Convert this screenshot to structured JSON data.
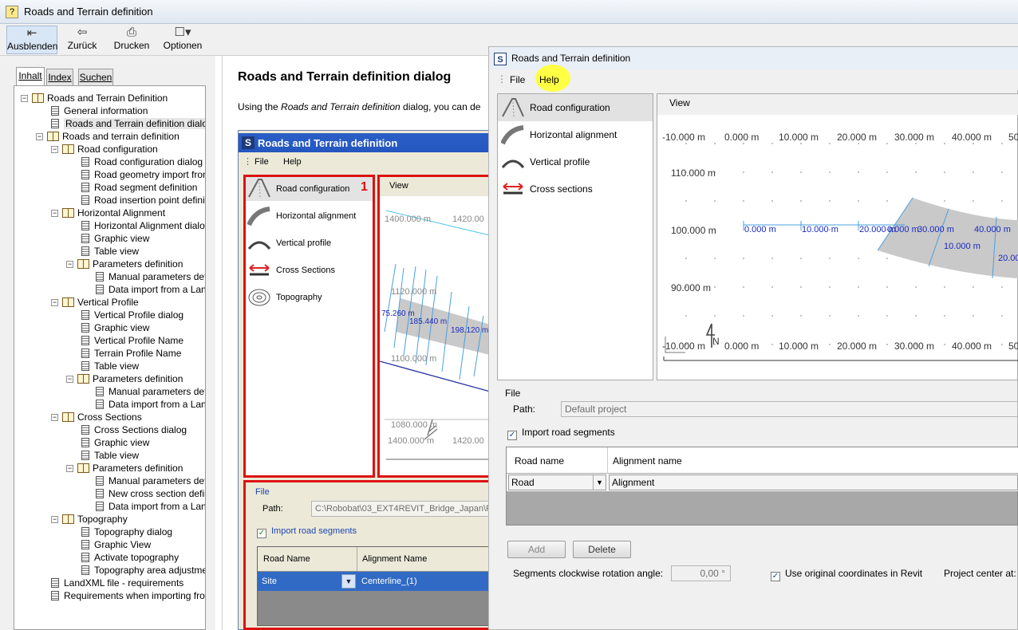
{
  "help_window": {
    "title": "Roads and Terrain definition",
    "toolbar": [
      {
        "label": "Ausblenden",
        "icon": "hide-icon"
      },
      {
        "label": "Zurück",
        "icon": "back-arrow-icon"
      },
      {
        "label": "Drucken",
        "icon": "printer-icon"
      },
      {
        "label": "Optionen",
        "icon": "options-icon"
      }
    ],
    "tabs": [
      "Inhalt",
      "Index",
      "Suchen"
    ],
    "tree": [
      {
        "label": "Roads and Terrain Definition"
      },
      {
        "label": "General information"
      },
      {
        "label": "Roads and Terrain definition dialog"
      },
      {
        "label": "Roads and terrain definition"
      },
      {
        "label": "Road configuration"
      },
      {
        "label": "Road configuration dialog"
      },
      {
        "label": "Road geometry import from a"
      },
      {
        "label": "Road segment definition"
      },
      {
        "label": "Road insertion point definitic"
      },
      {
        "label": "Horizontal Alignment"
      },
      {
        "label": "Horizontal Alignment dialog"
      },
      {
        "label": "Graphic view"
      },
      {
        "label": "Table view"
      },
      {
        "label": "Parameters definition"
      },
      {
        "label": "Manual parameters defi"
      },
      {
        "label": "Data import from a Lanc"
      },
      {
        "label": "Vertical Profile"
      },
      {
        "label": "Vertical Profile dialog"
      },
      {
        "label": "Graphic view"
      },
      {
        "label": "Vertical Profile Name"
      },
      {
        "label": "Terrain Profile Name"
      },
      {
        "label": "Table view"
      },
      {
        "label": "Parameters definition"
      },
      {
        "label": "Manual parameters defi"
      },
      {
        "label": "Data import from a Lanc"
      },
      {
        "label": "Cross Sections"
      },
      {
        "label": "Cross Sections dialog"
      },
      {
        "label": "Graphic view"
      },
      {
        "label": "Table view"
      },
      {
        "label": "Parameters definition"
      },
      {
        "label": "Manual parameters defi"
      },
      {
        "label": "New cross section defir"
      },
      {
        "label": "Data import from a Lanc"
      },
      {
        "label": "Topography"
      },
      {
        "label": "Topography dialog"
      },
      {
        "label": "Graphic View"
      },
      {
        "label": "Activate topography"
      },
      {
        "label": "Topography area adjustmer"
      },
      {
        "label": "LandXML file - requirements"
      },
      {
        "label": "Requirements when importing from /"
      }
    ],
    "content": {
      "heading": "Roads and Terrain definition dialog",
      "intro_pre": "Using the ",
      "intro_em": "Roads and Terrain definition",
      "intro_post": " dialog, you can de"
    }
  },
  "embedded_shot": {
    "title": "Roads and Terrain definition",
    "menu": [
      "File",
      "Help"
    ],
    "sidebar": [
      "Road configuration",
      "Horizontal alignment",
      "Vertical profile",
      "Cross Sections",
      "Topography"
    ],
    "callout": "1",
    "view_label": "View",
    "ruler_top": [
      "1400.000 m",
      "1420.00"
    ],
    "ruler_bottom": [
      "1400.000 m",
      "1420.00"
    ],
    "y_labels": [
      "1120.000 m",
      "1100.000 m",
      "1080.000 m"
    ],
    "stations": [
      "75.260 m",
      "185.440 m",
      "198.120 m"
    ],
    "file_group": "File",
    "path_label": "Path:",
    "path_value": "C:\\Robobat\\03_EXT4REVIT_Bridge_Japan\\F",
    "import_label": "Import road segments",
    "col1": "Road Name",
    "col2": "Alignment Name",
    "row_road": "Site",
    "row_alignment": "Centerline_(1)"
  },
  "dialog": {
    "title": "Roads and Terrain definition",
    "menu": [
      "File",
      "Help"
    ],
    "sidebar": [
      "Road configuration",
      "Horizontal alignment",
      "Vertical profile",
      "Cross sections"
    ],
    "view_label": "View",
    "x_ruler": [
      "-10.000 m",
      "0.000 m",
      "10.000 m",
      "20.000 m",
      "30.000 m",
      "40.000 m",
      "50"
    ],
    "y_ruler": [
      "110.000 m",
      "100.000 m",
      "90.000 m"
    ],
    "axis_marks": [
      "0.000 m",
      "10.000 m",
      "20.000 m"
    ],
    "road_marks": [
      "0.000 m",
      "30.000 m",
      "40.000 m",
      "10.000 m",
      "20.00"
    ],
    "compass": "N",
    "file_group": "File",
    "path_label": "Path:",
    "path_value": "Default project",
    "import_label": "Import road segments",
    "col1": "Road name",
    "col2": "Alignment name",
    "row_road": "Road",
    "row_alignment": "Alignment",
    "add": "Add",
    "delete": "Delete",
    "rotation_label": "Segments clockwise rotation angle:",
    "rotation_value": "0,00 °",
    "original_coords": "Use original coordinates in Revit",
    "project_center": "Project center at:"
  }
}
